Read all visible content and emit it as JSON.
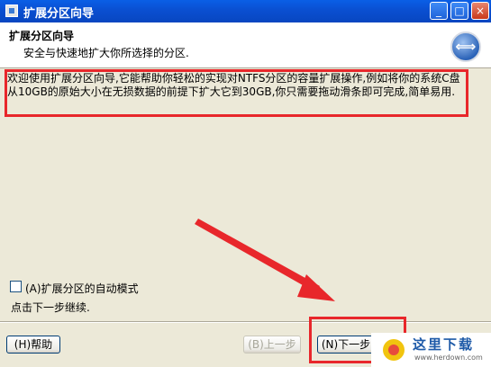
{
  "window": {
    "title": "扩展分区向导",
    "controls": {
      "minimize": "_",
      "maximize": "□",
      "close": "×"
    }
  },
  "header": {
    "title": "扩展分区向导",
    "subtitle": "安全与快速地扩大你所选择的分区.",
    "icon": "resize-arrows-icon"
  },
  "description": "欢迎使用扩展分区向导,它能帮助你轻松的实现对NTFS分区的容量扩展操作,例如将你的系统C盘从10GB的原始大小在无损数据的前提下扩大它到30GB,你只需要拖动滑条即可完成,简单易用.",
  "options": {
    "auto_mode_label": "(A)扩展分区的自动模式",
    "auto_mode_checked": false
  },
  "hint": "点击下一步继续.",
  "buttons": {
    "help": "(H)帮助",
    "back": "(B)上一步",
    "next": "(N)下一步"
  },
  "watermark": {
    "text": "这里下载",
    "url": "www.herdown.com"
  },
  "colors": {
    "annotation_red": "#e8272b",
    "titlebar_blue": "#0a4fd1"
  }
}
